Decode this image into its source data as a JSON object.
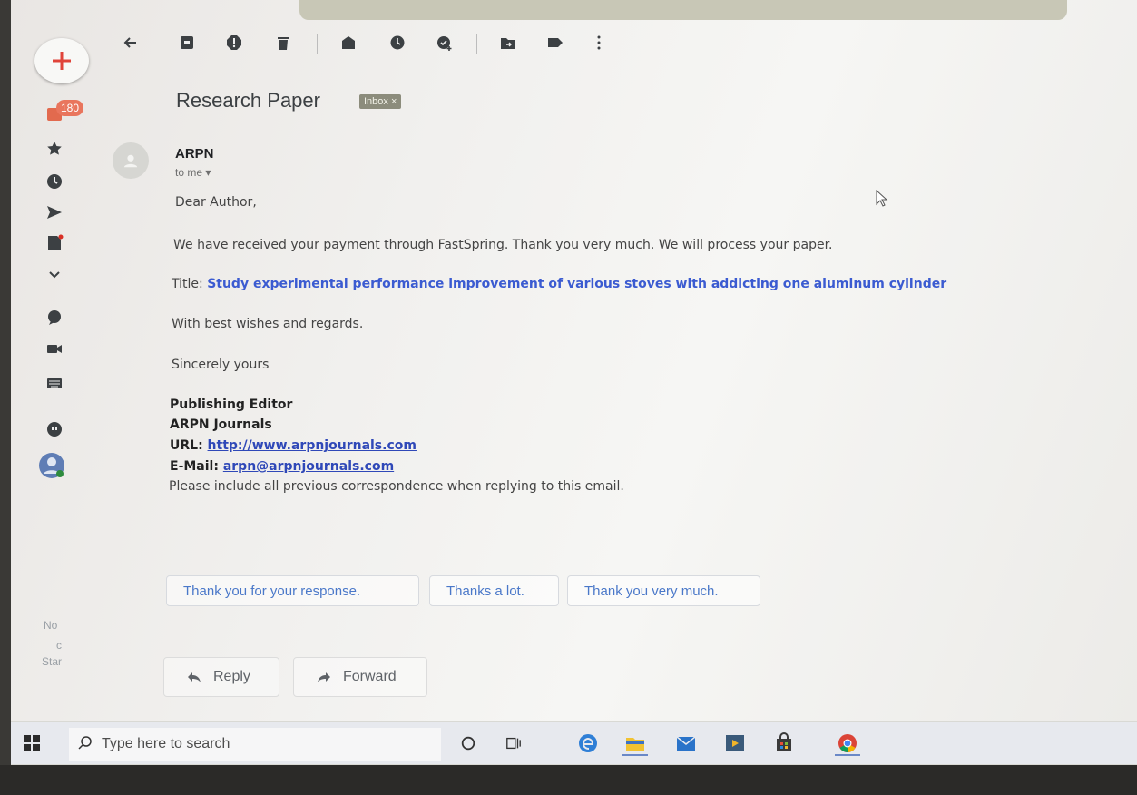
{
  "sidebar": {
    "unread_badge": "180",
    "faded_items": [
      "No",
      "c",
      "Star"
    ]
  },
  "message": {
    "subject": "Research Paper",
    "label_chip": "Inbox ×",
    "sender": "ARPN",
    "recipient": "to me ▾",
    "greeting": "Dear Author,",
    "body_line": "We have received your payment through FastSpring. Thank you very much. We will process your paper.",
    "title_label": "Title:",
    "title_value": "Study experimental performance improvement of various stoves with addicting one aluminum cylinder",
    "wishes": "With best wishes and regards.",
    "closing": "Sincerely yours",
    "signature": {
      "role": "Publishing Editor",
      "org": "ARPN Journals",
      "url_label": "URL:",
      "url": "http://www.arpnjournals.com",
      "email_label": "E-Mail:",
      "email": "arpn@arpnjournals.com"
    },
    "footer_note": "Please include all previous correspondence when replying to this email."
  },
  "smart_replies": [
    "Thank you for your response.",
    "Thanks a lot.",
    "Thank you very much."
  ],
  "actions": {
    "reply": "Reply",
    "forward": "Forward"
  },
  "taskbar": {
    "search_placeholder": "Type here to search"
  },
  "colors": {
    "link": "#2f48b8",
    "title_accent": "#3b5bd1",
    "badge": "#e9755d",
    "smart_reply_text": "#4a78c9"
  }
}
